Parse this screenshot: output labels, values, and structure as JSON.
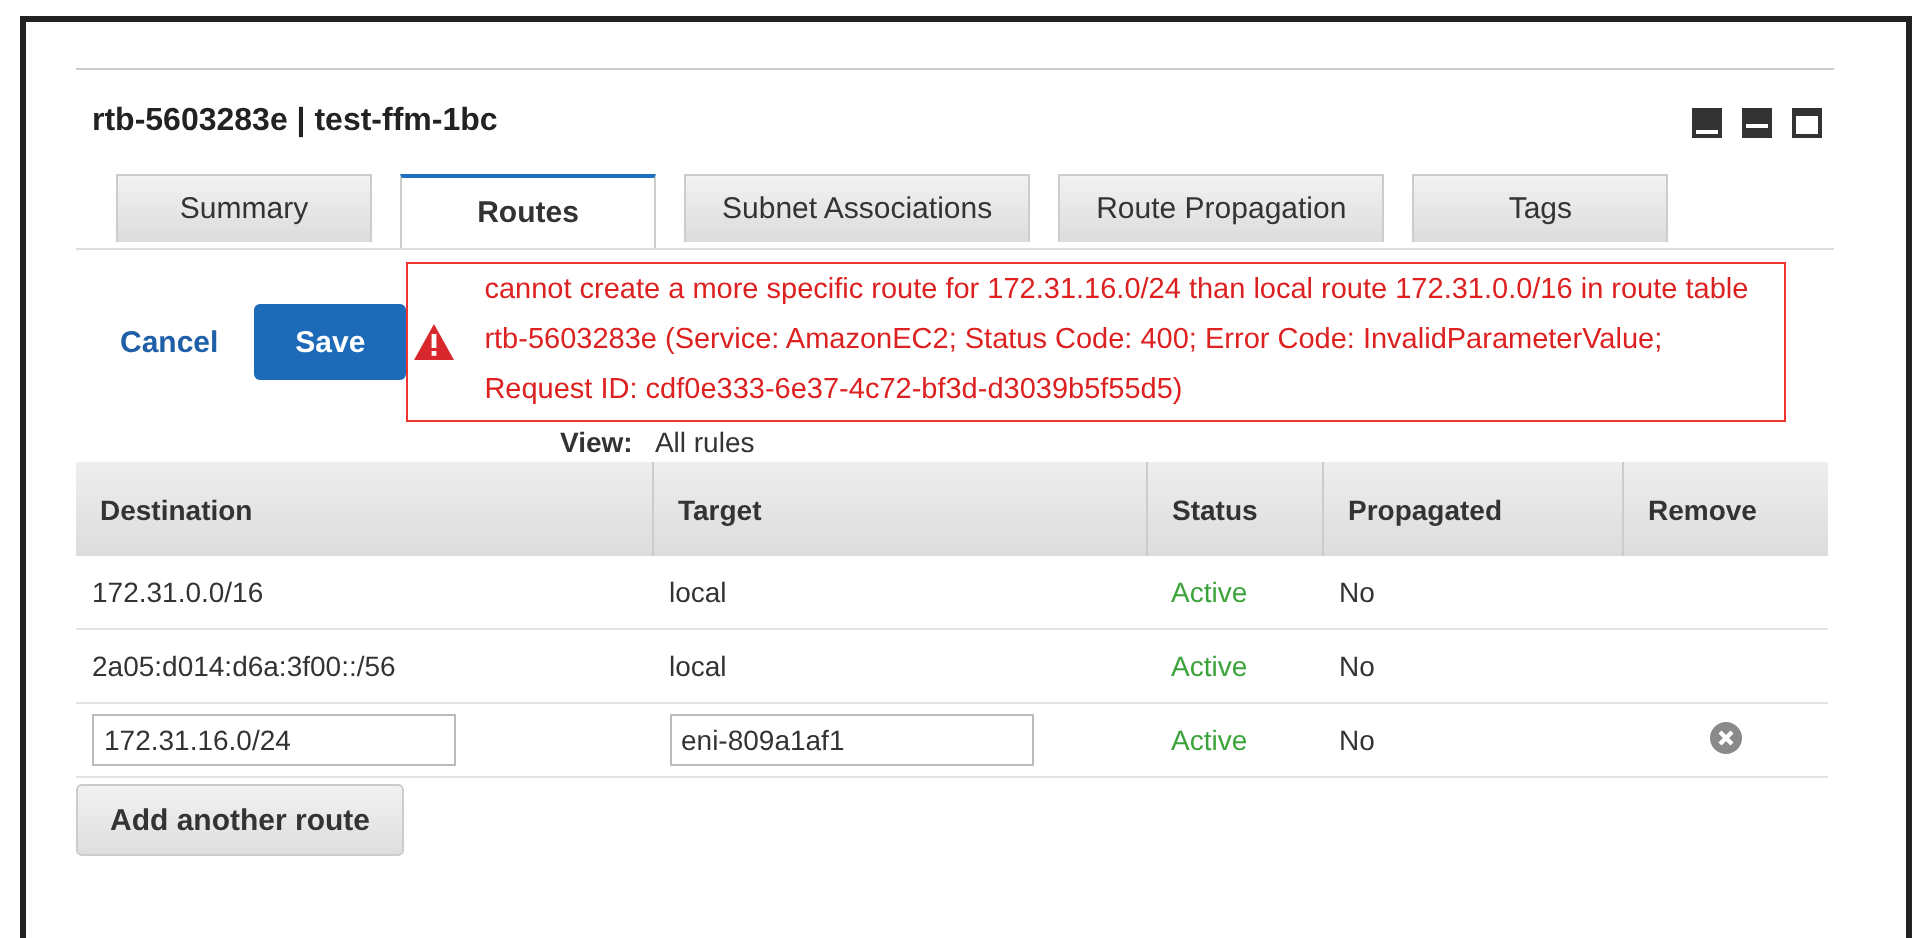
{
  "panel": {
    "title": "rtb-5603283e | test-ffm-1bc"
  },
  "tabs": [
    {
      "label": "Summary",
      "selected": false
    },
    {
      "label": "Routes",
      "selected": true
    },
    {
      "label": "Subnet Associations",
      "selected": false
    },
    {
      "label": "Route Propagation",
      "selected": false
    },
    {
      "label": "Tags",
      "selected": false
    }
  ],
  "actions": {
    "cancel": "Cancel",
    "save": "Save"
  },
  "error": "cannot create a more specific route for 172.31.16.0/24 than local route 172.31.0.0/16 in route table rtb-5603283e (Service: AmazonEC2; Status Code: 400; Error Code: InvalidParameterValue; Request ID: cdf0e333-6e37-4c72-bf3d-d3039b5f55d5)",
  "view": {
    "label": "View:",
    "value": "All rules"
  },
  "table": {
    "columns": [
      "Destination",
      "Target",
      "Status",
      "Propagated",
      "Remove"
    ],
    "rows": [
      {
        "kind": "text",
        "destination": "172.31.0.0/16",
        "target": "local",
        "status": "Active",
        "propagated": "No",
        "removable": false
      },
      {
        "kind": "text",
        "destination": "2a05:d014:d6a:3f00::/56",
        "target": "local",
        "status": "Active",
        "propagated": "No",
        "removable": false
      },
      {
        "kind": "input",
        "destination": "172.31.16.0/24",
        "target": "eni-809a1af1",
        "status": "Active",
        "propagated": "No",
        "removable": true
      }
    ]
  },
  "add_button": "Add another route"
}
